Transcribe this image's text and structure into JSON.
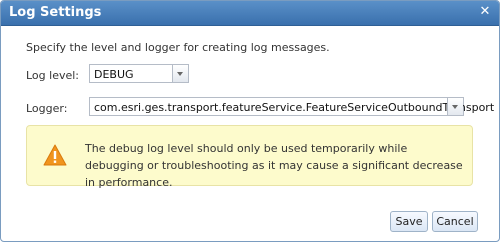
{
  "dialog": {
    "title": "Log Settings",
    "close_icon": "close-icon"
  },
  "intro_text": "Specify the level and logger for creating log messages.",
  "log_level": {
    "label": "Log level:",
    "value": "DEBUG"
  },
  "logger": {
    "label": "Logger:",
    "value": "com.esri.ges.transport.featureService.FeatureServiceOutboundTransport"
  },
  "warning": {
    "icon": "warning-icon",
    "text": "The debug log level should only be used temporarily while debugging or troubleshooting as it may cause a significant decrease in performance."
  },
  "buttons": {
    "save": "Save",
    "cancel": "Cancel"
  },
  "colors": {
    "title_bar": "#4a80bd",
    "warning_bg": "#fdfbcc",
    "warning_icon": "#f0941e"
  }
}
